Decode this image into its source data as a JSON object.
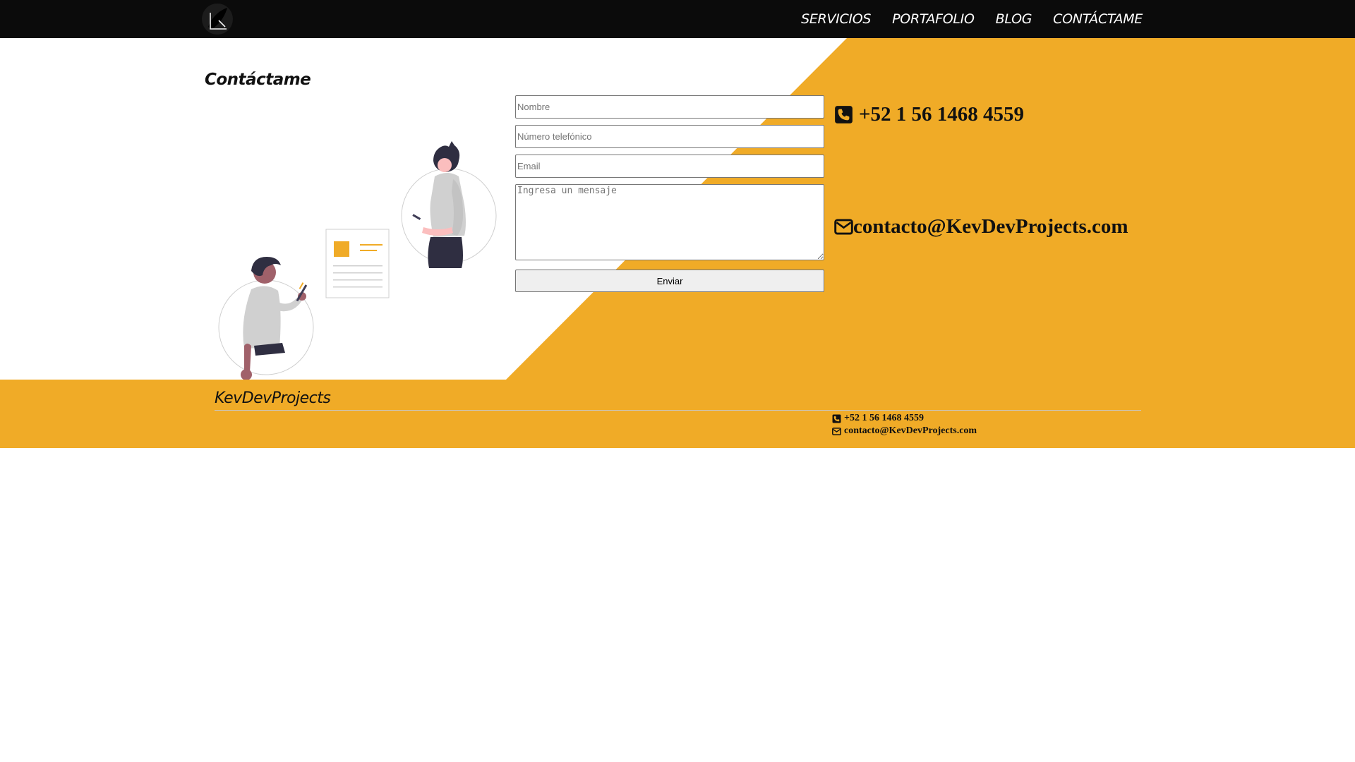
{
  "nav": {
    "logo_icon": "kdp-leaf-logo-icon",
    "links": [
      "SERVICIOS",
      "PORTAFOLIO",
      "BLOG",
      "CONTÁCTAME"
    ]
  },
  "contact": {
    "title": "Contáctame",
    "illustration": "people-with-phones-and-document-illustration",
    "form": {
      "name_placeholder": "Nombre",
      "phone_placeholder": "Número telefónico",
      "email_placeholder": "Email",
      "message_placeholder": "Ingresa un mensaje",
      "submit_label": "Enviar"
    },
    "info": {
      "phone_icon": "phone-square-icon",
      "phone": "+52 1 56 1468 4559",
      "email_icon": "envelope-icon",
      "email": "contacto@KevDevProjects.com"
    }
  },
  "footer": {
    "brand": "KevDevProjects",
    "phone_icon": "phone-square-icon",
    "phone": "+52 1 56 1468 4559",
    "email_icon": "envelope-icon",
    "email": "contacto@KevDevProjects.com"
  },
  "colors": {
    "navbar_bg": "#0b0b0b",
    "accent": "#f0ab27",
    "text": "#111111"
  }
}
